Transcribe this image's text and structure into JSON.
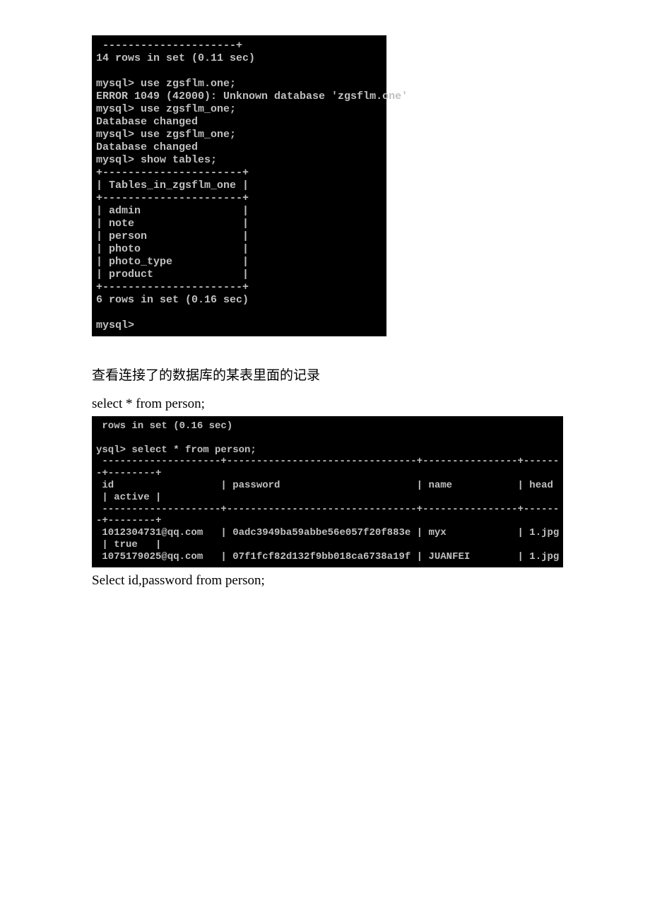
{
  "terminal1": {
    "line0": " ---------------------+",
    "line1": "14 rows in set (0.11 sec)",
    "blank1": "",
    "line2": "mysql> use zgsflm.one;",
    "line3": "ERROR 1049 (42000): Unknown database 'zgsflm.one'",
    "line4": "mysql> use zgsflm_one;",
    "line5": "Database changed",
    "line6": "mysql> use zgsflm_one;",
    "line7": "Database changed",
    "line8": "mysql> show tables;",
    "sep1": "+----------------------+",
    "hdr": "| Tables_in_zgsflm_one |",
    "sep2": "+----------------------+",
    "row1": "| admin                |",
    "row2": "| note                 |",
    "row3": "| person               |",
    "row4": "| photo                |",
    "row5": "| photo_type           |",
    "row6": "| product              |",
    "sep3": "+----------------------+",
    "summary": "6 rows in set (0.16 sec)",
    "blank2": "",
    "prompt": "mysql>"
  },
  "doc": {
    "paragraph1": "查看连接了的数据库的某表里面的记录",
    "sql1": "select * from person;",
    "sql2": "Select id,password from person;"
  },
  "terminal2": {
    "line1": " rows in set (0.16 sec)",
    "blank1": "",
    "line2": "ysql> select * from person;",
    "sep1": " --------------------+--------------------------------+----------------+------",
    "sep1b": "-+--------+",
    "hdr": " id                  | password                       | name           | head ",
    "hdr2": " | active |",
    "sep2": " --------------------+--------------------------------+----------------+------",
    "sep2b": "-+--------+",
    "row1": " 1012304731@qq.com   | 0adc3949ba59abbe56e057f20f883e | myx            | 1.jpg",
    "row1b": " | true   |",
    "row2": " 1075179025@qq.com   | 07f1fcf82d132f9bb018ca6738a19f | JUANFEI        | 1.jpg"
  }
}
